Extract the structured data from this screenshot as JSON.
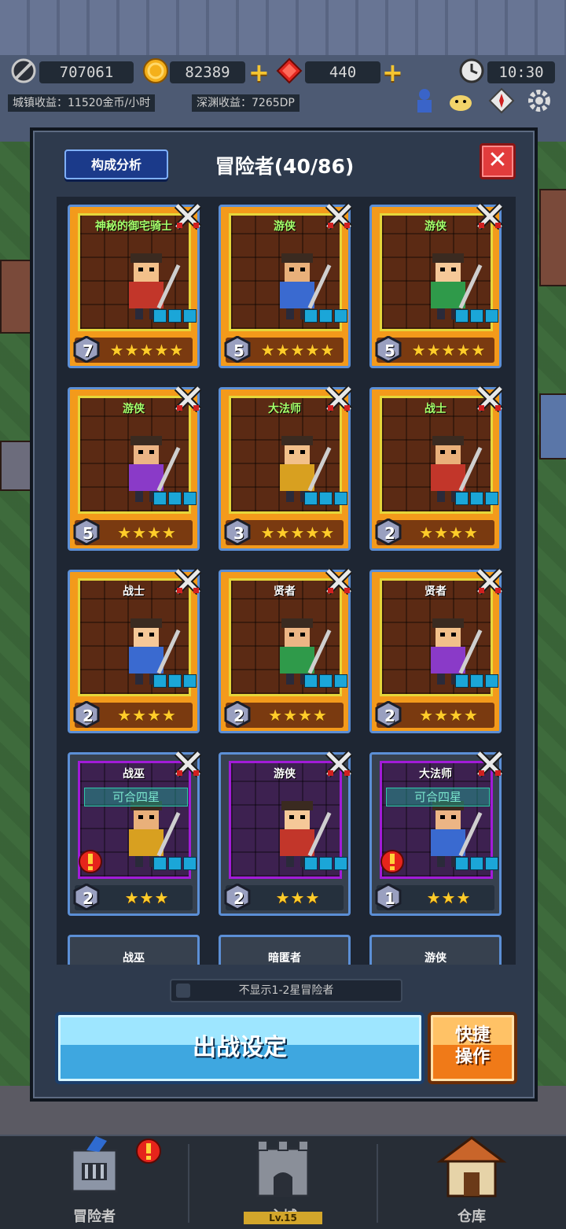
{
  "hud": {
    "resources": [
      {
        "icon": "moon-icon",
        "value": "707061"
      },
      {
        "icon": "gold-coin-icon",
        "value": "82389"
      },
      {
        "icon": "red-gem-icon",
        "value": "440"
      }
    ],
    "time": "10:30",
    "town_income": "城镇收益：11520金币/小时",
    "abyss_income": "深渊收益：7265DP"
  },
  "panel": {
    "analysis_label": "构成分析",
    "title": "冒险者(40/86)",
    "close_label": "✕",
    "hide_toggle_label": "不显示1-2星冒险者",
    "battle_label": "出战设定",
    "quick_label_1": "快捷",
    "quick_label_2": "操作"
  },
  "cards": [
    {
      "name": "神秘的御宅骑士",
      "level": "7",
      "stars": "★★★★★",
      "tier": "gold",
      "highlight": true
    },
    {
      "name": "游侠",
      "level": "5",
      "stars": "★★★★★",
      "tier": "gold",
      "highlight": true
    },
    {
      "name": "游侠",
      "level": "5",
      "stars": "★★★★★",
      "tier": "gold",
      "highlight": true
    },
    {
      "name": "游侠",
      "level": "5",
      "stars": "★★★★",
      "tier": "gold",
      "highlight": true
    },
    {
      "name": "大法师",
      "level": "3",
      "stars": "★★★★★",
      "tier": "gold",
      "highlight": true
    },
    {
      "name": "战士",
      "level": "2",
      "stars": "★★★★",
      "tier": "gold",
      "highlight": true
    },
    {
      "name": "战士",
      "level": "2",
      "stars": "★★★★",
      "tier": "gold",
      "highlight": false
    },
    {
      "name": "贤者",
      "level": "2",
      "stars": "★★★★",
      "tier": "gold",
      "highlight": false
    },
    {
      "name": "贤者",
      "level": "2",
      "stars": "★★★★",
      "tier": "gold",
      "highlight": false
    },
    {
      "name": "战巫",
      "level": "2",
      "stars": "★★★",
      "tier": "gray",
      "highlight": false,
      "merge": "可合四星",
      "alert": true
    },
    {
      "name": "游侠",
      "level": "2",
      "stars": "★★★",
      "tier": "gray",
      "highlight": false
    },
    {
      "name": "大法师",
      "level": "1",
      "stars": "★★★",
      "tier": "gray",
      "highlight": false,
      "merge": "可合四星",
      "alert": true
    }
  ],
  "partial_cards": [
    "战巫",
    "暗匿者",
    "游侠"
  ],
  "nav": [
    {
      "label": "冒险者",
      "icon": "knight-helmet-icon"
    },
    {
      "label": "主城",
      "icon": "castle-icon",
      "sub": "Lv.15"
    },
    {
      "label": "仓库",
      "icon": "warehouse-icon"
    }
  ],
  "colors": {
    "accent": "#f39a1b",
    "frame": "#5c8fd6",
    "battle": "#3ea7e0",
    "quick": "#f07a18"
  }
}
